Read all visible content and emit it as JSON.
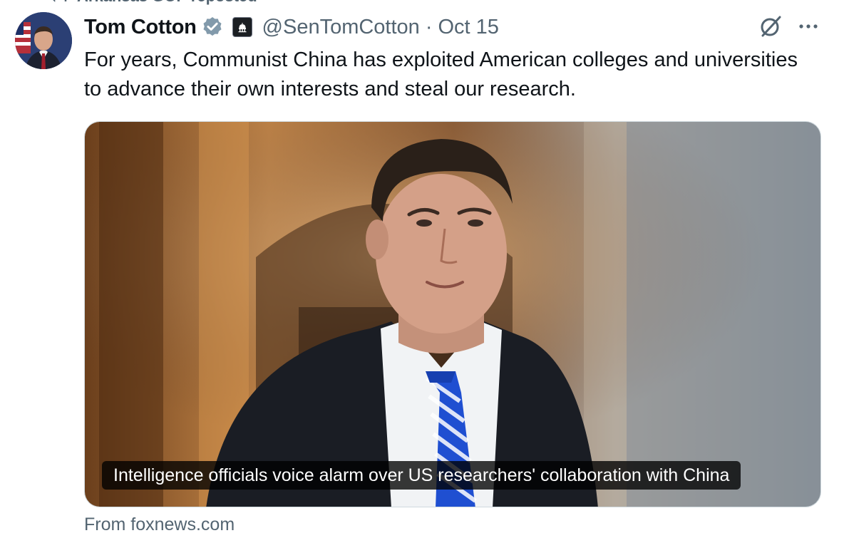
{
  "repost": {
    "text": "Arkansas GOP reposted",
    "icon": "repost-icon"
  },
  "tweet": {
    "author_name": "Tom Cotton",
    "handle": "@SenTomCotton",
    "separator": "·",
    "date": "Oct 15",
    "verified_badge": "verified-icon",
    "affiliation_badge": "government-building-icon",
    "text": "For years, Communist China has exploited American colleges and universities to advance their own interests and steal our research."
  },
  "card": {
    "caption": "Intelligence officials voice alarm over US researchers' collaboration with China",
    "source": "From foxnews.com"
  },
  "actions": {
    "grok": "grok-icon",
    "more": "more-icon"
  },
  "colors": {
    "text": "#0f1419",
    "secondary": "#536471",
    "verified": "#1d9bf0",
    "tie": "#1f4fd1"
  }
}
